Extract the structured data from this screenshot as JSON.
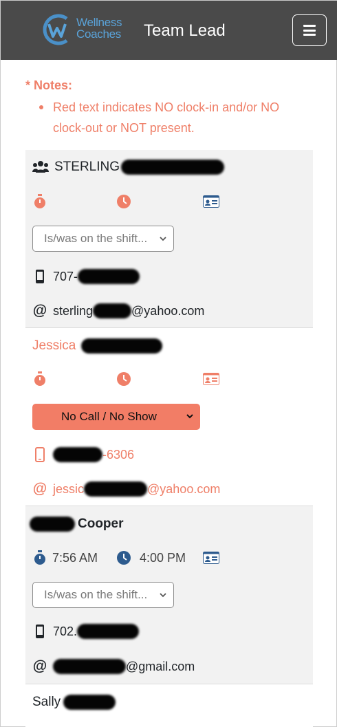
{
  "header": {
    "logo_line1": "Wellness",
    "logo_line2": "Coaches",
    "title": "Team Lead",
    "menu_icon": "hamburger-menu-icon"
  },
  "notes": {
    "title": "* Notes:",
    "items": [
      "Red text indicates NO clock-in and/or NO clock-out or NOT present."
    ]
  },
  "colors": {
    "header_bg": "#4a4a4a",
    "accent_red": "#ef7f68",
    "alert_select": "#f27d66",
    "icon_blue": "#2d5b8e",
    "card_gray": "#f2f2f2"
  },
  "staff": [
    {
      "name_prefix": "STERLING",
      "name_suffix": "",
      "clock_in": "",
      "clock_out": "",
      "status": "Is/was on the shift...",
      "phone_prefix": "707-",
      "phone_suffix": "",
      "email_prefix": "sterling",
      "email_suffix": "@yahoo.com"
    },
    {
      "name_prefix": "Jessica",
      "name_suffix": "",
      "clock_in": "",
      "clock_out": "",
      "status": "No Call / No Show",
      "phone_prefix": "",
      "phone_suffix": "-6306",
      "email_prefix": "jessic",
      "email_suffix": "@yahoo.com"
    },
    {
      "name_prefix": "",
      "name_suffix": "Cooper",
      "clock_in": "7:56 AM",
      "clock_out": "4:00 PM",
      "status": "Is/was on the shift...",
      "phone_prefix": "702.",
      "phone_suffix": "",
      "email_prefix": "",
      "email_suffix": "@gmail.com"
    },
    {
      "name_prefix": "Sally",
      "name_suffix": ""
    }
  ]
}
